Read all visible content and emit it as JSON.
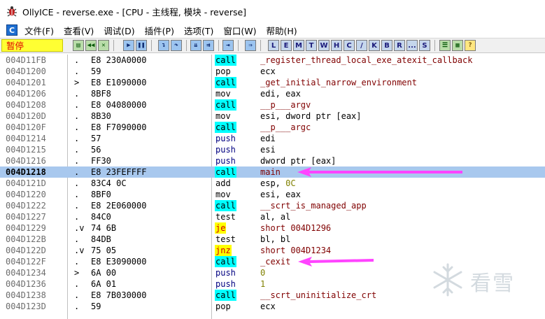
{
  "window": {
    "title": "OllyICE - reverse.exe - [CPU - 主线程, 模块 - reverse]"
  },
  "menu": {
    "icon_letter": "C",
    "items": [
      "文件(F)",
      "查看(V)",
      "调试(D)",
      "插件(P)",
      "选项(T)",
      "窗口(W)",
      "帮助(H)"
    ]
  },
  "toolbar": {
    "status": "暂停",
    "letter_buttons": [
      "L",
      "E",
      "M",
      "T",
      "W",
      "H",
      "C",
      "/",
      "K",
      "B",
      "R",
      "...",
      "S"
    ]
  },
  "disassembly": {
    "rows": [
      {
        "addr": "004D11FB",
        "mark": ".",
        "hex": "E8 230A0000",
        "mnem": "call",
        "ops": "_register_thread_local_exe_atexit_callback"
      },
      {
        "addr": "004D1200",
        "mark": ".",
        "hex": "59",
        "mnem": "pop",
        "ops": "ecx"
      },
      {
        "addr": "004D1201",
        "mark": ">",
        "hex": "E8 E1090000",
        "mnem": "call",
        "ops": "_get_initial_narrow_environment"
      },
      {
        "addr": "004D1206",
        "mark": ".",
        "hex": "8BF8",
        "mnem": "mov",
        "ops": "edi, eax"
      },
      {
        "addr": "004D1208",
        "mark": ".",
        "hex": "E8 04080000",
        "mnem": "call",
        "ops": "__p___argv"
      },
      {
        "addr": "004D120D",
        "mark": ".",
        "hex": "8B30",
        "mnem": "mov",
        "ops": "esi, dword ptr [eax]"
      },
      {
        "addr": "004D120F",
        "mark": ".",
        "hex": "E8 F7090000",
        "mnem": "call",
        "ops": "__p___argc"
      },
      {
        "addr": "004D1214",
        "mark": ".",
        "hex": "57",
        "mnem": "push",
        "ops": "edi"
      },
      {
        "addr": "004D1215",
        "mark": ".",
        "hex": "56",
        "mnem": "push",
        "ops": "esi"
      },
      {
        "addr": "004D1216",
        "mark": ".",
        "hex": "FF30",
        "mnem": "push",
        "ops": "dword ptr [eax]"
      },
      {
        "addr": "004D1218",
        "mark": ".",
        "hex": "E8 23FEFFFF",
        "mnem": "call",
        "ops": "main"
      },
      {
        "addr": "004D121D",
        "mark": ".",
        "hex": "83C4 0C",
        "mnem": "add",
        "ops": "esp, 0C"
      },
      {
        "addr": "004D1220",
        "mark": ".",
        "hex": "8BF0",
        "mnem": "mov",
        "ops": "esi, eax"
      },
      {
        "addr": "004D1222",
        "mark": ".",
        "hex": "E8 2E060000",
        "mnem": "call",
        "ops": "__scrt_is_managed_app"
      },
      {
        "addr": "004D1227",
        "mark": ".",
        "hex": "84C0",
        "mnem": "test",
        "ops": "al, al"
      },
      {
        "addr": "004D1229",
        "mark": ".v",
        "hex": "74 6B",
        "mnem": "je",
        "ops": "short 004D1296"
      },
      {
        "addr": "004D122B",
        "mark": ".",
        "hex": "84DB",
        "mnem": "test",
        "ops": "bl, bl"
      },
      {
        "addr": "004D122D",
        "mark": ".v",
        "hex": "75 05",
        "mnem": "jnz",
        "ops": "short 004D1234"
      },
      {
        "addr": "004D122F",
        "mark": ".",
        "hex": "E8 E3090000",
        "mnem": "call",
        "ops": "_cexit"
      },
      {
        "addr": "004D1234",
        "mark": ">",
        "hex": "6A 00",
        "mnem": "push",
        "ops": "0"
      },
      {
        "addr": "004D1236",
        "mark": ".",
        "hex": "6A 01",
        "mnem": "push",
        "ops": "1"
      },
      {
        "addr": "004D1238",
        "mark": ".",
        "hex": "E8 7B030000",
        "mnem": "call",
        "ops": "__scrt_uninitialize_crt"
      },
      {
        "addr": "004D123D",
        "mark": ".",
        "hex": "59",
        "mnem": "pop",
        "ops": "ecx"
      }
    ],
    "selected_addr": "004D1218"
  },
  "watermark": {
    "text": "看雪"
  },
  "colors": {
    "selection": "#a8c8ee",
    "call_highlight": "#00ffff",
    "jump_highlight": "#ffff00",
    "arrow": "#ff44ff",
    "status_bg": "#ffff33",
    "status_fg": "#e00000"
  }
}
